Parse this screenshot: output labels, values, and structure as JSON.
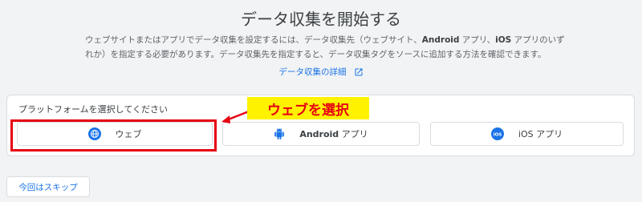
{
  "header": {
    "title": "データ収集を開始する",
    "description": {
      "line1_pre": "ウェブサイトまたはアプリでデータ収集を設定するには、データ収集先（ウェブサイト、",
      "line1_android": "Android",
      "line1_mid": " アプリ、",
      "line1_ios": "iOS",
      "line1_post": " アプリのいず",
      "line2": "れか）を指定する必要があります。データ収集先を指定すると、データ収集タグをソースに追加する方法を確認できます。"
    },
    "details_link": "データ収集の詳細"
  },
  "platform_panel": {
    "label": "プラットフォームを選択してください",
    "options": [
      {
        "label": "ウェブ",
        "icon": "globe-icon"
      },
      {
        "label": "Android アプリ",
        "label_bold": "Android",
        "label_rest": " アプリ",
        "icon": "android-icon"
      },
      {
        "label": "iOS アプリ",
        "label_prefix": "iOS",
        "label_rest": " アプリ",
        "icon": "ios-icon"
      }
    ]
  },
  "annotation": {
    "callout_text": "ウェブを選択",
    "highlight_color": "#e60012",
    "callout_bg": "#fff200"
  },
  "footer": {
    "skip_label": "今回はスキップ"
  },
  "colors": {
    "accent": "#1a73e8",
    "background": "#f1f3f4",
    "panel": "#ffffff"
  }
}
